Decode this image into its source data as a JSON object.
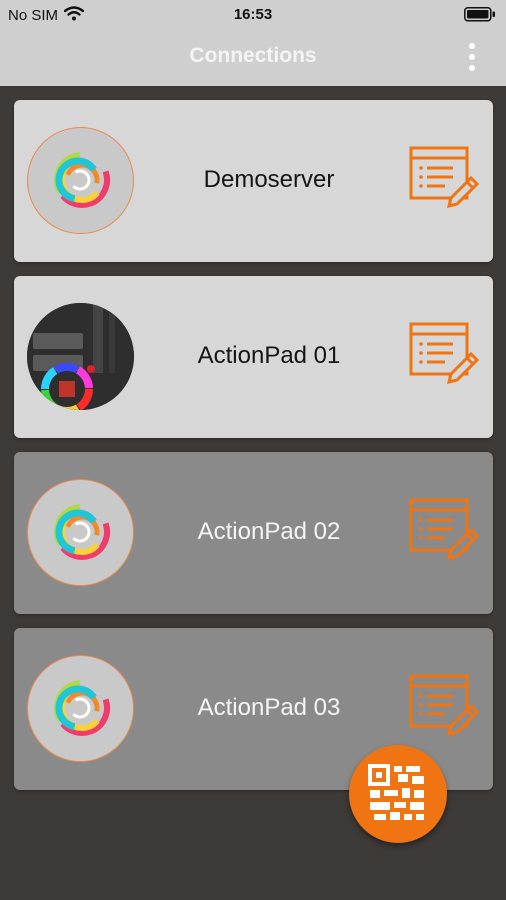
{
  "status_bar": {
    "carrier": "No SIM",
    "time": "16:53"
  },
  "header": {
    "title": "Connections",
    "menu_icon": "more-vertical-icon"
  },
  "connections": [
    {
      "name": "Demoserver",
      "avatar": "app-logo",
      "state": "active"
    },
    {
      "name": "ActionPad 01",
      "avatar": "color-wheel-screenshot",
      "state": "active"
    },
    {
      "name": "ActionPad 02",
      "avatar": "app-logo",
      "state": "inactive"
    },
    {
      "name": "ActionPad 03",
      "avatar": "app-logo",
      "state": "inactive"
    }
  ],
  "fab": {
    "icon": "qr-code-icon"
  },
  "colors": {
    "accent": "#f07412",
    "header_bg": "#cfcfcf",
    "background": "#3d3a38",
    "card_active": "#d7d7d7",
    "card_inactive": "#8a8a8a"
  }
}
